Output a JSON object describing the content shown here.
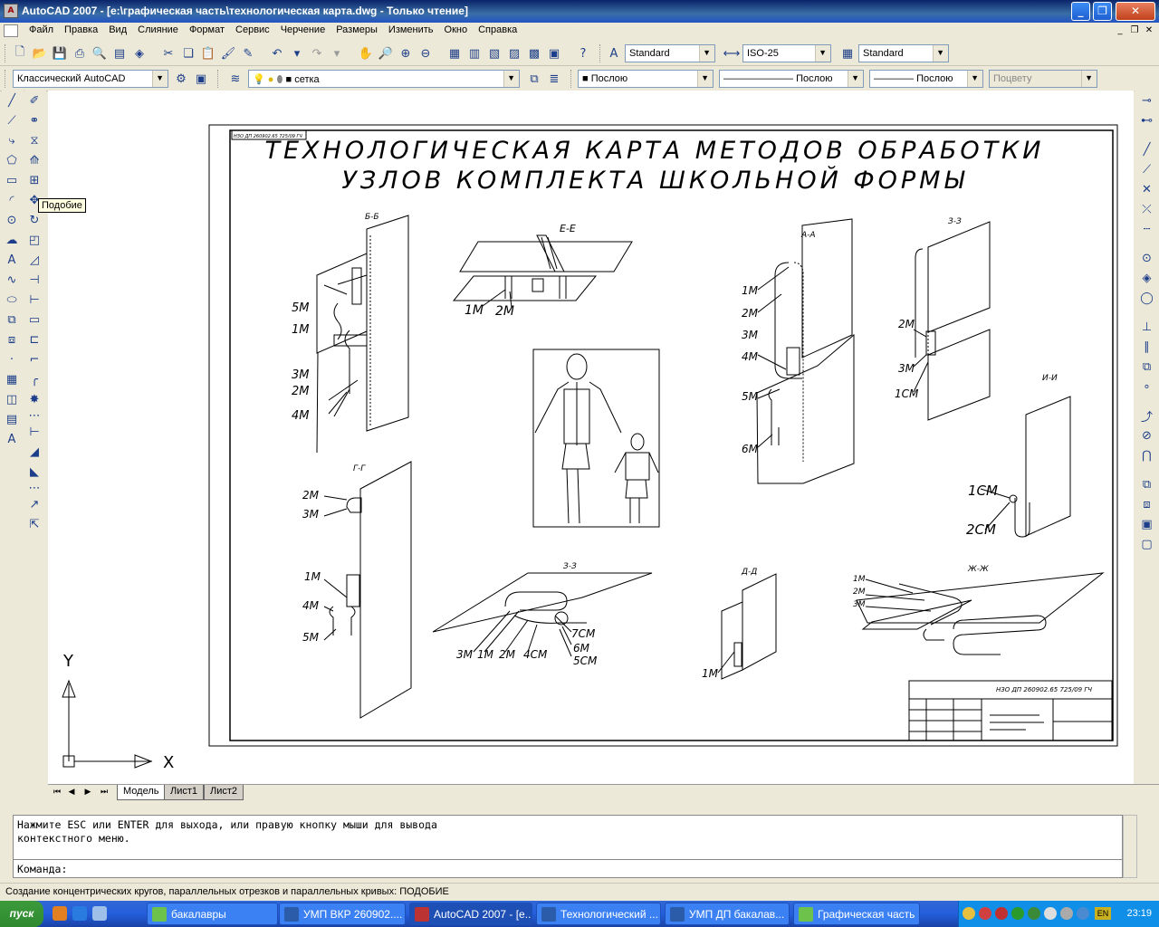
{
  "window": {
    "title": "AutoCAD 2007 - [e:\\графическая часть\\технологическая карта.dwg - Только чтение]",
    "app_icon_text": "A"
  },
  "menu": [
    "Файл",
    "Правка",
    "Вид",
    "Слияние",
    "Формат",
    "Сервис",
    "Черчение",
    "Размеры",
    "Изменить",
    "Окно",
    "Справка"
  ],
  "styles_toolbar": {
    "text_style": "Standard",
    "dim_style": "ISO-25",
    "table_style": "Standard"
  },
  "layers_toolbar": {
    "workspace": "Классический AutoCAD",
    "layer": "сетка",
    "color": "Послою",
    "linetype": "Послою",
    "lineweight": "Послою",
    "plotstyle": "Поцвету"
  },
  "tooltip": "Подобие",
  "drawing": {
    "title_line1": "ТЕХНОЛОГИЧЕСКАЯ КАРТА МЕТОДОВ ОБРАБОТКИ",
    "title_line2": "УЗЛОВ КОМПЛЕКТА ШКОЛЬНОЙ ФОРМЫ",
    "stamp_code": "НЗО ДП 260902.65 725/09 ГЧ",
    "corner_code": "НЗО ДП 260902.65 725/09 ГЧ",
    "ucs_y": "Y",
    "ucs_x": "X",
    "sections": {
      "bb": "Б-Б",
      "ee": "Е-Е",
      "aa": "А-А",
      "zz": "З-З",
      "ii": "И-И",
      "gg": "Г-Г",
      "zz2": "З-З",
      "dd": "Д-Д",
      "zh": "Ж-Ж"
    },
    "labels": {
      "bb": [
        "5М",
        "1М",
        "3М",
        "2М",
        "4М"
      ],
      "ee": [
        "1М",
        "2М"
      ],
      "aa": [
        "1М",
        "2М",
        "3М",
        "4М",
        "5М",
        "6М"
      ],
      "zz": [
        "2М",
        "3М",
        "1СМ"
      ],
      "ii": [
        "1СМ",
        "2СМ"
      ],
      "gg": [
        "2М",
        "3М",
        "1М",
        "4М",
        "5М"
      ],
      "zz2": [
        "3М",
        "1М",
        "2М",
        "4СМ",
        "7СМ",
        "6М",
        "5СМ"
      ],
      "dd": [
        "1М"
      ],
      "zh": [
        "1М",
        "2М",
        "3М"
      ]
    }
  },
  "tabs": [
    "Модель",
    "Лист1",
    "Лист2"
  ],
  "command": {
    "line1": "Нажмите ESC или ENTER для выхода, или правую кнопку мыши для вывода",
    "line2": "контекстного меню.",
    "prompt": "Команда:"
  },
  "status": "Создание концентрических кругов, параллельных отрезков и параллельных кривых:  ПОДОБИЕ",
  "taskbar": {
    "start": "пуск",
    "tasks": [
      "бакалавры",
      "УМП ВКР 260902....",
      "AutoCAD 2007 - [e...",
      "Технологический ...",
      "УМП ДП бакалав...",
      "Графическая часть"
    ],
    "lang": "EN",
    "clock": "23:19"
  }
}
